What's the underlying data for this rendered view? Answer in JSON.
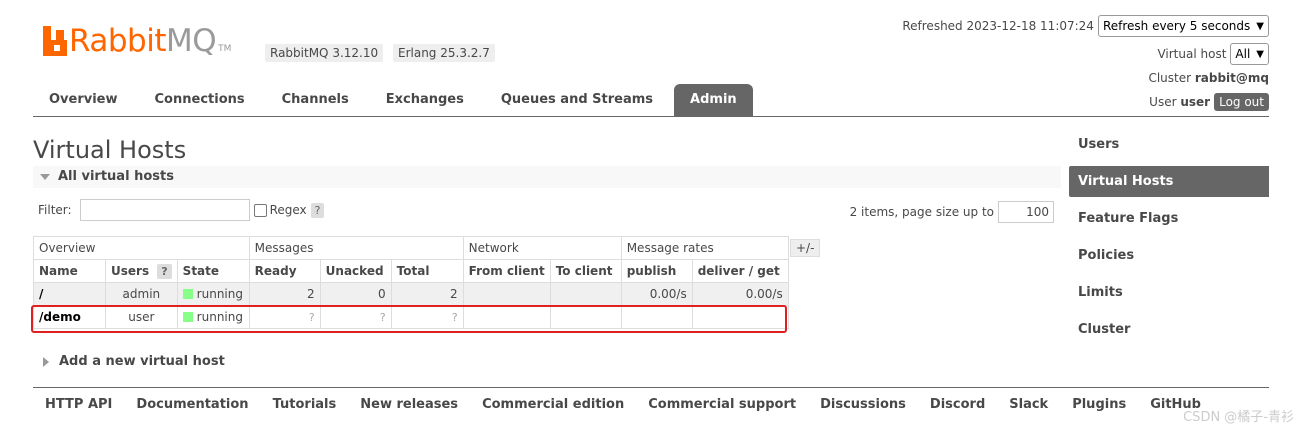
{
  "header": {
    "logo_rabbit": "Rabbit",
    "logo_mq": "MQ",
    "logo_tm": "TM",
    "rabbitmq_version": "RabbitMQ 3.12.10",
    "erlang_version": "Erlang 25.3.2.7",
    "refreshed_text": "Refreshed 2023-12-18 11:07:24",
    "refresh_select": "Refresh every 5 seconds",
    "vhost_label": "Virtual host",
    "vhost_select": "All",
    "cluster_label": "Cluster",
    "cluster_name": "rabbit@mq",
    "user_label": "User",
    "user_name": "user",
    "logout_label": "Log out"
  },
  "tabs": [
    {
      "label": "Overview"
    },
    {
      "label": "Connections"
    },
    {
      "label": "Channels"
    },
    {
      "label": "Exchanges"
    },
    {
      "label": "Queues and Streams"
    },
    {
      "label": "Admin",
      "active": true
    }
  ],
  "main": {
    "title": "Virtual Hosts",
    "section_label": "All virtual hosts",
    "filter_label": "Filter:",
    "filter_value": "",
    "regex_label": "Regex",
    "help_mark": "?",
    "items_text": "2 items, page size up to",
    "page_size": "100",
    "plus_minus": "+/-",
    "add_vhost_label": "Add a new virtual host"
  },
  "table": {
    "groups": [
      "Overview",
      "Messages",
      "Network",
      "Message rates"
    ],
    "columns": [
      "Name",
      "Users",
      "State",
      "Ready",
      "Unacked",
      "Total",
      "From client",
      "To client",
      "publish",
      "deliver / get"
    ],
    "rows": [
      {
        "name": "/",
        "users": "admin",
        "state": "running",
        "ready": "2",
        "unacked": "0",
        "total": "2",
        "from_client": "",
        "to_client": "",
        "publish": "0.00/s",
        "deliver_get": "0.00/s"
      },
      {
        "name": "/demo",
        "users": "user",
        "state": "running",
        "ready": "?",
        "unacked": "?",
        "total": "?",
        "from_client": "",
        "to_client": "",
        "publish": "",
        "deliver_get": ""
      }
    ]
  },
  "sidebar": {
    "items": [
      {
        "label": "Users"
      },
      {
        "label": "Virtual Hosts",
        "active": true
      },
      {
        "label": "Feature Flags"
      },
      {
        "label": "Policies"
      },
      {
        "label": "Limits"
      },
      {
        "label": "Cluster"
      }
    ]
  },
  "footer": {
    "links": [
      "HTTP API",
      "Documentation",
      "Tutorials",
      "New releases",
      "Commercial edition",
      "Commercial support",
      "Discussions",
      "Discord",
      "Slack",
      "Plugins",
      "GitHub"
    ]
  },
  "watermark": "CSDN @橘子-青衫",
  "colors": {
    "brand_orange": "#ff6600",
    "tab_active_bg": "#666666",
    "running_green": "#88ff88",
    "highlight_red": "#e02020"
  }
}
